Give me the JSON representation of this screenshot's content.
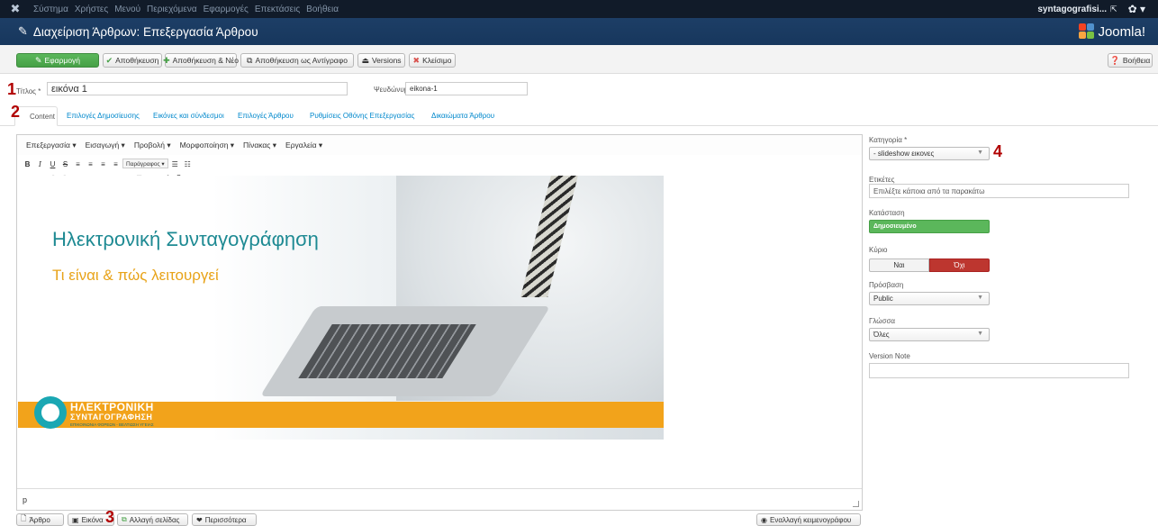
{
  "topbar": {
    "menu": [
      "Σύστημα",
      "Χρήστες",
      "Μενού",
      "Περιεχόμενα",
      "Εφαρμογές",
      "Επεκτάσεις",
      "Βοήθεια"
    ],
    "user": "syntagografisi...",
    "external_icon": "external-link-icon",
    "gear_icon": "gear-icon"
  },
  "header": {
    "title": "Διαχείριση Άρθρων: Επεξεργασία Άρθρου",
    "brand": "Joomla!"
  },
  "toolbar": {
    "apply": "Εφαρμογή",
    "save": "Αποθήκευση",
    "save_new": "Αποθήκευση & Νέο",
    "save_copy": "Αποθήκευση ως Αντίγραφο",
    "versions": "Versions",
    "close": "Κλείσιμο",
    "help": "Βοήθεια"
  },
  "markers": {
    "one": "1",
    "two": "2",
    "three": "3",
    "four": "4"
  },
  "form": {
    "title_label": "Τίτλος *",
    "title_value": "εικόνα 1",
    "alias_label": "Ψευδώνυμο",
    "alias_value": "eikona-1"
  },
  "tabs": [
    "Content",
    "Επιλογές Δημοσίευσης",
    "Εικόνες και σύνδεσμοι",
    "Επιλογές Άρθρου",
    "Ρυθμίσεις Οθόνης Επεξεργασίας",
    "Δικαιώματα Άρθρου"
  ],
  "editor": {
    "menu": [
      "Επεξεργασία ▾",
      "Εισαγωγή ▾",
      "Προβολή ▾",
      "Μορφοποίηση ▾",
      "Πίνακας ▾",
      "Εργαλεία ▾"
    ],
    "format_select": "Παράγραφος ▾",
    "statusbar": "p",
    "banner": {
      "heading": "Ηλεκτρονική Συνταγογράφηση",
      "subheading": "Τι είναι & πώς λειτουργεί",
      "logo_line1": "ΗΛΕΚΤΡΟΝΙΚΗ",
      "logo_line2": "ΣΥΝΤΑΓΟΓΡΑΦΗΣΗ",
      "logo_line3": "ΕΠΙΚΟΙΝΩΝΙΑ ΦΟΡΕΩΝ - ΒΕΛΤΙΩΣΗ ΥΓΕΙΑΣ"
    }
  },
  "bottom_buttons": {
    "article": "Άρθρο",
    "image": "Εικόνα",
    "page_break": "Αλλαγή σελίδας",
    "more": "Περισσότερα",
    "toggle_editor": "Εναλλαγή κειμενογράφου"
  },
  "sidebar": {
    "category_label": "Κατηγορία *",
    "category_value": "- slideshow εικονες",
    "tags_label": "Ετικέτες",
    "tags_placeholder": "Επιλέξτε κάποια από τα παρακάτω",
    "status_label": "Κατάσταση",
    "status_value": "Δημοσιευμένο",
    "featured_label": "Κύριο",
    "featured_yes": "Ναι",
    "featured_no": "Όχι",
    "access_label": "Πρόσβαση",
    "access_value": "Public",
    "language_label": "Γλώσσα",
    "language_value": "Όλες",
    "version_note_label": "Version Note",
    "version_note_value": ""
  }
}
